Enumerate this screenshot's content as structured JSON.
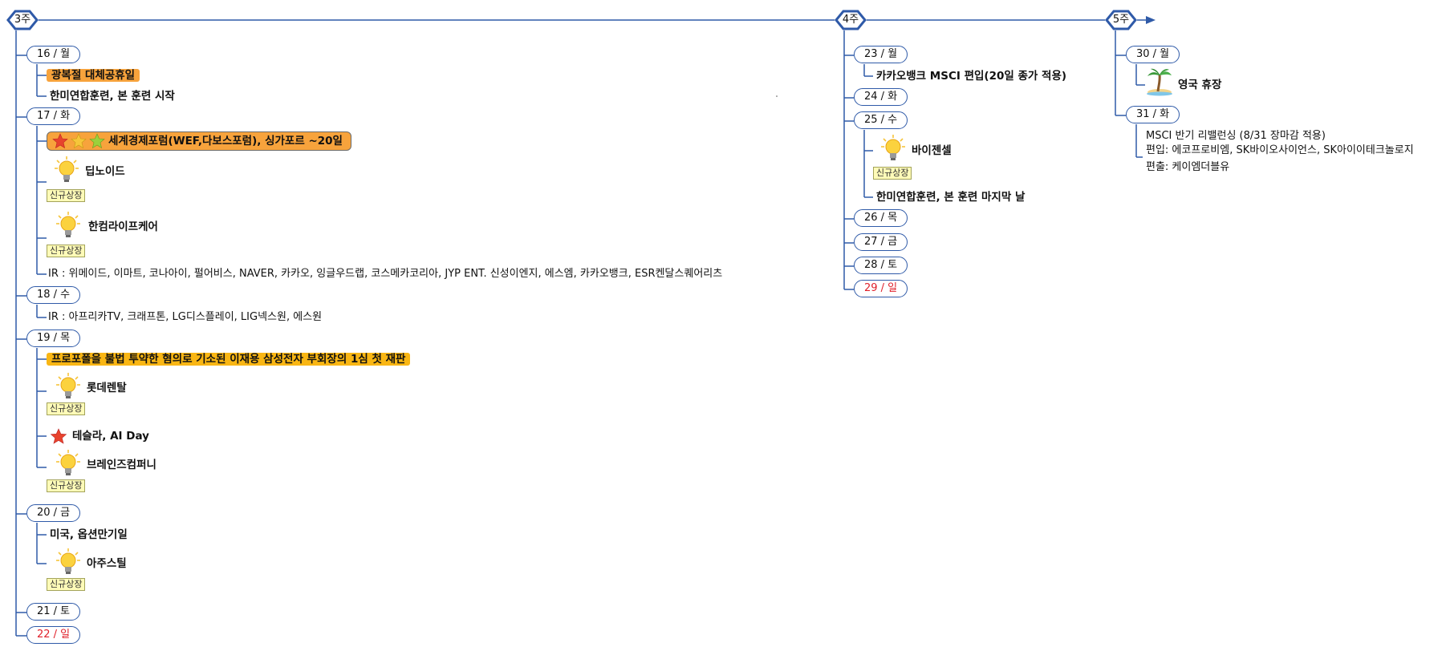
{
  "tags": {
    "new_listing": "신규상장"
  },
  "weeks": [
    {
      "label": "3주",
      "days": [
        {
          "label": "16 / 월",
          "events": [
            "광복절 대체공휴일",
            "한미연합훈련, 본 훈련 시작"
          ]
        },
        {
          "label": "17 / 화",
          "events": [
            "세계경제포럼(WEF,다보스포럼), 싱가포르 ~20일",
            "딥노이드",
            "한컴라이프케어",
            "IR : 위메이드, 이마트, 코나아이, 펄어비스, NAVER, 카카오, 잉글우드랩, 코스메카코리아, JYP ENT. 신성이엔지, 에스엠, 카카오뱅크, ESR켄달스퀘어리츠"
          ]
        },
        {
          "label": "18 / 수",
          "events": [
            "IR : 아프리카TV, 크래프톤, LG디스플레이, LIG넥스원, 에스원"
          ]
        },
        {
          "label": "19 / 목",
          "events": [
            "프로포폴을 불법 투약한 혐의로 기소된 이재용 삼성전자 부회장의 1심 첫 재판",
            "롯데렌탈",
            "테슬라, AI Day",
            "브레인즈컴퍼니"
          ]
        },
        {
          "label": "20 / 금",
          "events": [
            "미국, 옵션만기일",
            "아주스틸"
          ]
        },
        {
          "label": "21 / 토",
          "events": []
        },
        {
          "label": "22 / 일",
          "events": []
        }
      ]
    },
    {
      "label": "4주",
      "days": [
        {
          "label": "23 / 월",
          "events": [
            "카카오뱅크 MSCI 편입(20일 종가 적용)"
          ]
        },
        {
          "label": "24 / 화",
          "events": []
        },
        {
          "label": "25 / 수",
          "events": [
            "바이젠셀",
            "한미연합훈련, 본 훈련 마지막 날"
          ]
        },
        {
          "label": "26 / 목",
          "events": []
        },
        {
          "label": "27 / 금",
          "events": []
        },
        {
          "label": "28 / 토",
          "events": []
        },
        {
          "label": "29 / 일",
          "events": []
        }
      ]
    },
    {
      "label": "5주",
      "days": [
        {
          "label": "30 / 월",
          "events": [
            "영국 휴장"
          ]
        },
        {
          "label": "31 / 화",
          "events": [
            "MSCI 반기 리밸런싱 (8/31 장마감 적용)",
            "편입: 에코프로비엠, SK바이오사이언스, SK아이이테크놀로지",
            "편출: 케이엠더블유"
          ]
        }
      ]
    }
  ],
  "colors": {
    "line": "#2f5aa8",
    "highlight_orange": "#f7a33c",
    "highlight_yellow": "#f9b614",
    "weekend_red": "#e0202a",
    "badge_bg": "#fffbb8"
  }
}
